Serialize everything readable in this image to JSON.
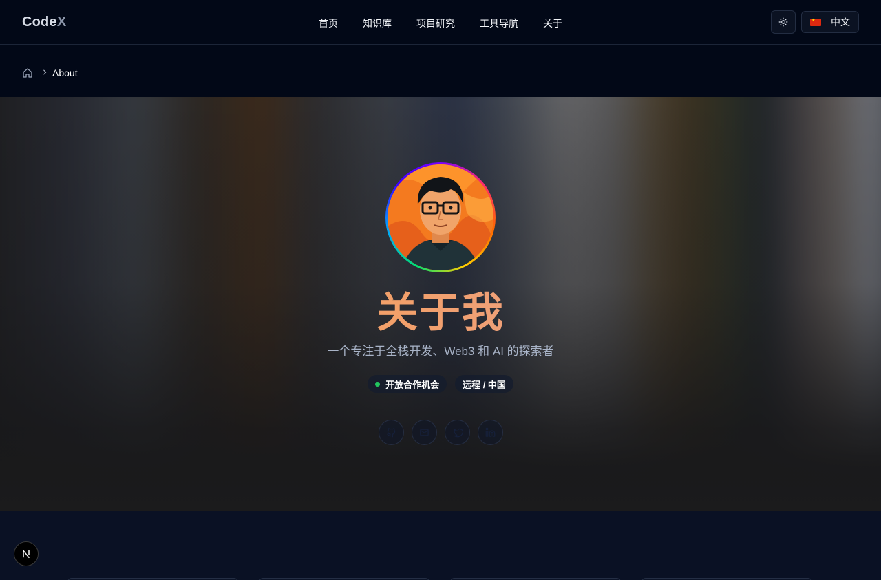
{
  "header": {
    "logo_main": "Code",
    "logo_accent": "X",
    "nav": [
      "首页",
      "知识库",
      "项目研究",
      "工具导航",
      "关于"
    ],
    "theme_icon": "sun-icon",
    "language_label": "中文",
    "language_flag": "china-flag-icon"
  },
  "breadcrumb": {
    "home_icon": "home-icon",
    "current": "About"
  },
  "hero": {
    "title": "关于我",
    "subtitle": "一个专注于全栈开发、Web3 和 AI 的探索者",
    "badges": [
      {
        "label": "开放合作机会",
        "status_color": "#22c55e"
      },
      {
        "label": "远程 / 中国"
      }
    ],
    "socials": [
      "github-icon",
      "mail-icon",
      "twitter-icon",
      "linkedin-icon"
    ]
  },
  "floating": {
    "next_logo": "N"
  },
  "colors": {
    "background": "#0a1124",
    "header": "#020817",
    "title_gradient_start": "#e79a76",
    "title_gradient_end": "#e7a2a6"
  }
}
